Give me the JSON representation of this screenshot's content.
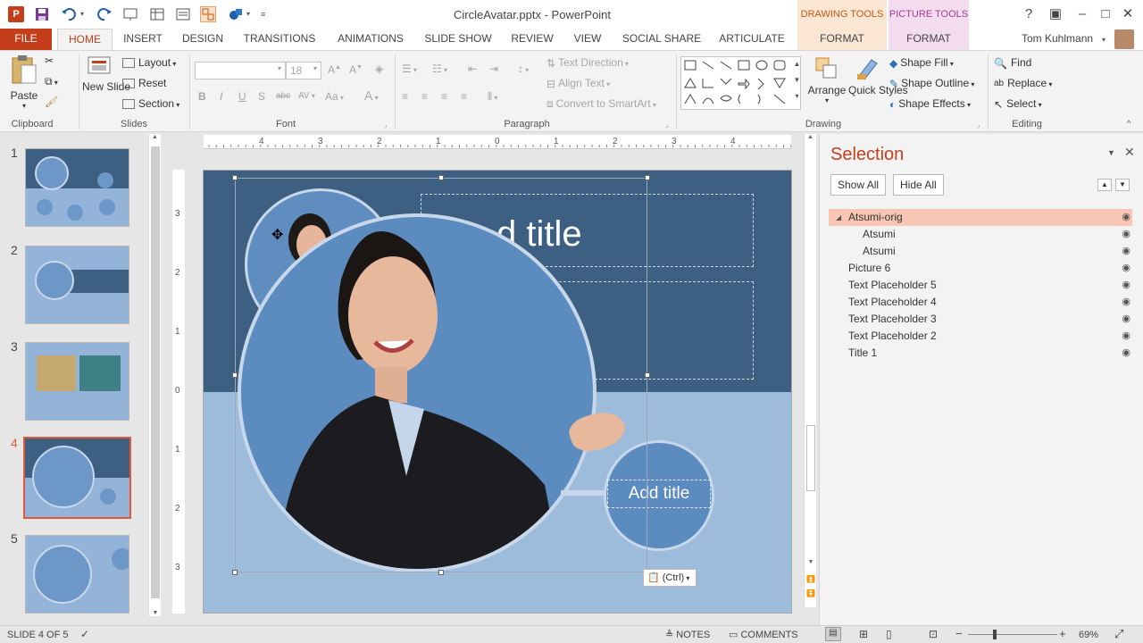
{
  "window": {
    "title": "CircleAvatar.pptx - PowerPoint",
    "ctx_drawing": "DRAWING TOOLS",
    "ctx_picture": "PICTURE TOOLS",
    "help": "?",
    "user": "Tom Kuhlmann"
  },
  "tabs": [
    "FILE",
    "HOME",
    "INSERT",
    "DESIGN",
    "TRANSITIONS",
    "ANIMATIONS",
    "SLIDE SHOW",
    "REVIEW",
    "VIEW",
    "SOCIAL SHARE",
    "ARTICULATE",
    "FORMAT",
    "FORMAT"
  ],
  "ribbon": {
    "clipboard": {
      "paste": "Paste",
      "label": "Clipboard"
    },
    "slides": {
      "new_slide": "New Slide",
      "layout": "Layout",
      "reset": "Reset",
      "section": "Section",
      "label": "Slides"
    },
    "font": {
      "size": "18",
      "bold": "B",
      "italic": "I",
      "underline": "U",
      "shadow": "S",
      "strike": "abc",
      "spacing": "AV",
      "case": "Aa",
      "color": "A",
      "label": "Font"
    },
    "paragraph": {
      "text_direction": "Text Direction",
      "align_text": "Align Text",
      "smartart": "Convert to SmartArt",
      "label": "Paragraph"
    },
    "drawing": {
      "arrange": "Arrange",
      "quick_styles": "Quick Styles",
      "shape_fill": "Shape Fill",
      "shape_outline": "Shape Outline",
      "shape_effects": "Shape Effects",
      "label": "Drawing"
    },
    "editing": {
      "find": "Find",
      "replace": "Replace",
      "select": "Select",
      "label": "Editing"
    }
  },
  "thumbnails": [
    "1",
    "2",
    "3",
    "4",
    "5"
  ],
  "selected_slide": 4,
  "slide": {
    "title_text": "Add title",
    "title_fragment": "d title",
    "paste_ctrl": "(Ctrl)"
  },
  "ruler": {
    "h": [
      "4",
      "3",
      "2",
      "1",
      "0",
      "1",
      "2",
      "3",
      "4"
    ],
    "v": [
      "3",
      "2",
      "1",
      "0",
      "1",
      "2",
      "3"
    ]
  },
  "selection_pane": {
    "title": "Selection",
    "show_all": "Show All",
    "hide_all": "Hide All",
    "items": [
      {
        "label": "Atsumi-orig",
        "indent": 1,
        "active": true
      },
      {
        "label": "Atsumi",
        "indent": 2,
        "active": false
      },
      {
        "label": "Atsumi",
        "indent": 2,
        "active": false
      },
      {
        "label": "Picture 6",
        "indent": 1,
        "active": false
      },
      {
        "label": "Text Placeholder 5",
        "indent": 1,
        "active": false
      },
      {
        "label": "Text Placeholder 4",
        "indent": 1,
        "active": false
      },
      {
        "label": "Text Placeholder 3",
        "indent": 1,
        "active": false
      },
      {
        "label": "Text Placeholder 2",
        "indent": 1,
        "active": false
      },
      {
        "label": "Title 1",
        "indent": 1,
        "active": false
      }
    ]
  },
  "status": {
    "slide_info": "SLIDE 4 OF 5",
    "notes": "NOTES",
    "comments": "COMMENTS",
    "zoom": "69%"
  }
}
